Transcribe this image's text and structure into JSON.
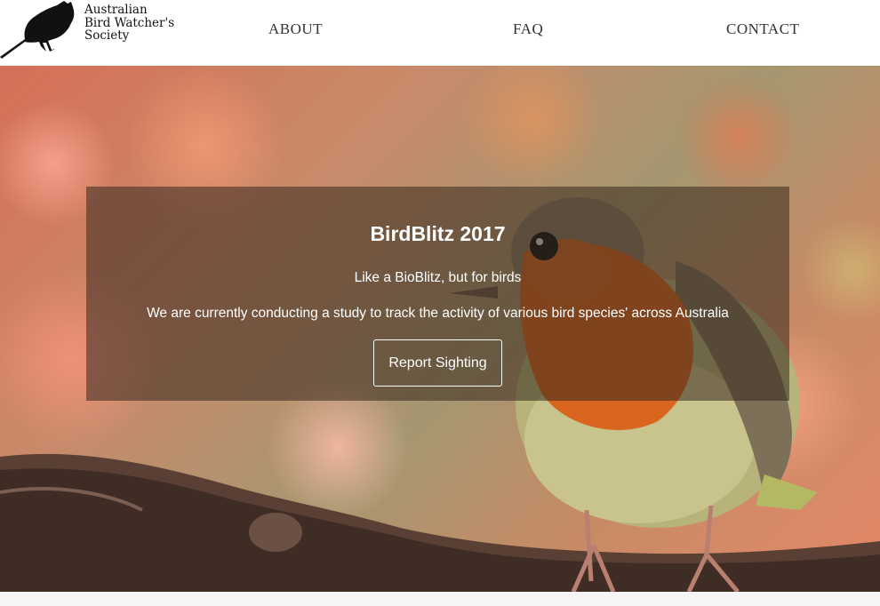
{
  "logo": {
    "lines": [
      "Australian",
      "Bird Watcher's",
      "Society"
    ],
    "icon": "bird-silhouette"
  },
  "nav": {
    "items": [
      {
        "label": "ABOUT"
      },
      {
        "label": "FAQ"
      },
      {
        "label": "CONTACT"
      }
    ]
  },
  "hero": {
    "title": "BirdBlitz 2017",
    "subtitle": "Like a BioBlitz, but for birds",
    "description": "We are currently conducting a study to track the activity of various bird species' across Australia",
    "cta_label": "Report Sighting",
    "background_image": "robin-on-branch"
  },
  "colors": {
    "header_bg": "#ffffff",
    "nav_text": "#333333",
    "overlay": "rgba(55,40,30,0.55)",
    "hero_text": "#ffffff"
  }
}
